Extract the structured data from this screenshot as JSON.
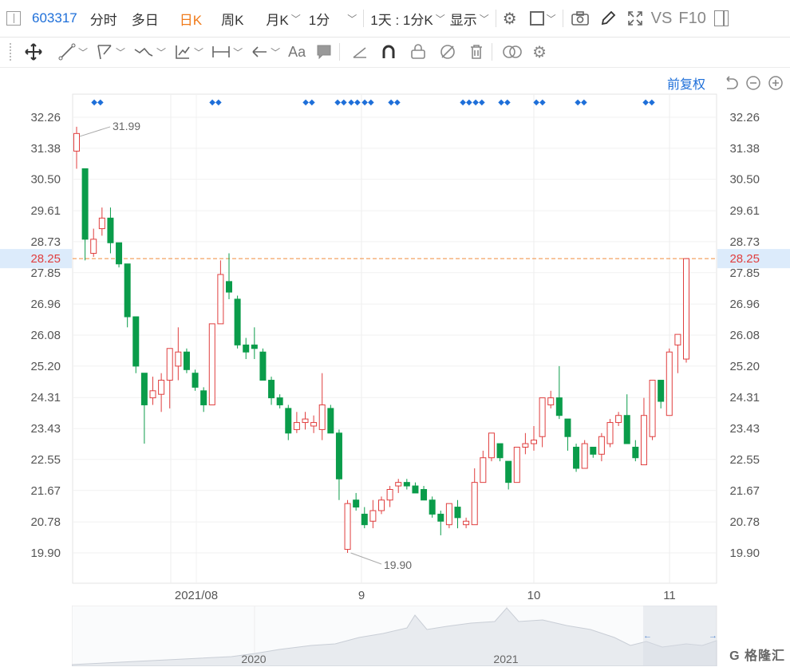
{
  "toolbar": {
    "stock_code": "603317",
    "tabs": [
      {
        "label": "分时",
        "active": false
      },
      {
        "label": "多日",
        "active": false
      },
      {
        "label": "日K",
        "active": true
      },
      {
        "label": "周K",
        "active": false
      },
      {
        "label": "月K",
        "active": false
      },
      {
        "label": "1分",
        "active": false
      }
    ],
    "range_label": "1天 : 1分K",
    "display_label": "显示",
    "vs_label": "VS",
    "f10_label": "F10"
  },
  "adjust_label": "前复权",
  "colors": {
    "up": "#e03e3e",
    "down": "#0a9c4a",
    "accent": "#1e6fd9",
    "current_line": "#f08c3c"
  },
  "chart_data": {
    "type": "candlestick",
    "y_ticks": [
      "32.26",
      "31.38",
      "30.50",
      "29.61",
      "28.73",
      "27.85",
      "26.96",
      "26.08",
      "25.20",
      "24.31",
      "23.43",
      "22.55",
      "21.67",
      "20.78",
      "19.90"
    ],
    "x_labels": [
      "2021/08",
      "9",
      "10",
      "11"
    ],
    "current_price": "28.25",
    "high_label": "31.99",
    "low_label": "19.90",
    "candles": [
      [
        31.3,
        31.8,
        30.8,
        31.99
      ],
      [
        30.8,
        28.8,
        28.2,
        30.8
      ],
      [
        28.4,
        28.8,
        28.3,
        29.1
      ],
      [
        29.1,
        29.4,
        28.9,
        29.7
      ],
      [
        29.4,
        28.7,
        28.4,
        29.7
      ],
      [
        28.7,
        28.1,
        28.0,
        28.7
      ],
      [
        28.1,
        26.6,
        26.3,
        28.1
      ],
      [
        26.6,
        25.2,
        25.0,
        26.6
      ],
      [
        25.0,
        24.1,
        23.0,
        25.0
      ],
      [
        24.3,
        24.5,
        24.1,
        24.9
      ],
      [
        24.4,
        24.8,
        23.9,
        25.0
      ],
      [
        24.8,
        25.7,
        24.0,
        25.7
      ],
      [
        25.2,
        25.6,
        24.8,
        26.3
      ],
      [
        25.6,
        25.1,
        25.0,
        25.7
      ],
      [
        25.0,
        24.6,
        24.5,
        25.1
      ],
      [
        24.5,
        24.1,
        23.9,
        24.6
      ],
      [
        24.1,
        26.4,
        24.1,
        26.4
      ],
      [
        26.4,
        27.8,
        26.4,
        28.2
      ],
      [
        27.6,
        27.3,
        27.1,
        28.4
      ],
      [
        27.1,
        25.8,
        25.7,
        27.2
      ],
      [
        25.8,
        25.6,
        25.4,
        26.0
      ],
      [
        25.8,
        25.7,
        25.4,
        26.3
      ],
      [
        25.6,
        24.8,
        24.8,
        25.7
      ],
      [
        24.8,
        24.3,
        24.1,
        24.9
      ],
      [
        24.3,
        24.1,
        24.0,
        24.4
      ],
      [
        24.0,
        23.3,
        23.1,
        24.1
      ],
      [
        23.4,
        23.6,
        23.3,
        23.9
      ],
      [
        23.6,
        23.7,
        23.4,
        23.9
      ],
      [
        23.5,
        23.6,
        23.3,
        23.8
      ],
      [
        23.4,
        24.1,
        23.1,
        25.0
      ],
      [
        24.0,
        23.3,
        23.3,
        24.1
      ],
      [
        23.3,
        22.0,
        21.4,
        23.4
      ],
      [
        20.0,
        21.3,
        19.9,
        21.4
      ],
      [
        21.4,
        21.2,
        21.1,
        21.6
      ],
      [
        21.0,
        20.7,
        20.6,
        21.2
      ],
      [
        20.8,
        21.1,
        20.6,
        21.4
      ],
      [
        21.1,
        21.4,
        21.0,
        21.5
      ],
      [
        21.4,
        21.7,
        21.2,
        21.8
      ],
      [
        21.8,
        21.9,
        21.6,
        22.0
      ],
      [
        21.9,
        21.8,
        21.7,
        22.0
      ],
      [
        21.8,
        21.6,
        21.6,
        21.9
      ],
      [
        21.7,
        21.4,
        21.4,
        21.8
      ],
      [
        21.4,
        21.0,
        20.9,
        21.5
      ],
      [
        21.0,
        20.8,
        20.4,
        21.1
      ],
      [
        20.7,
        21.3,
        20.6,
        21.3
      ],
      [
        21.2,
        20.9,
        20.6,
        21.4
      ],
      [
        20.7,
        20.8,
        20.6,
        20.9
      ],
      [
        20.7,
        21.9,
        20.7,
        22.3
      ],
      [
        21.9,
        22.6,
        21.9,
        22.8
      ],
      [
        22.6,
        23.3,
        22.5,
        23.3
      ],
      [
        23.0,
        22.6,
        22.5,
        23.0
      ],
      [
        22.5,
        21.9,
        21.7,
        22.5
      ],
      [
        21.9,
        22.9,
        21.9,
        22.9
      ],
      [
        22.9,
        23.0,
        22.7,
        23.3
      ],
      [
        23.0,
        23.1,
        22.8,
        23.5
      ],
      [
        23.2,
        24.3,
        22.9,
        24.3
      ],
      [
        24.1,
        24.3,
        24.0,
        24.5
      ],
      [
        24.3,
        23.8,
        23.7,
        25.2
      ],
      [
        23.7,
        23.2,
        22.8,
        23.7
      ],
      [
        22.9,
        22.3,
        22.2,
        23.0
      ],
      [
        22.3,
        23.0,
        22.3,
        23.1
      ],
      [
        22.9,
        22.7,
        22.6,
        22.9
      ],
      [
        22.7,
        23.2,
        22.5,
        23.3
      ],
      [
        23.0,
        23.6,
        22.9,
        23.7
      ],
      [
        23.6,
        23.8,
        23.5,
        23.9
      ],
      [
        23.8,
        23.0,
        23.0,
        24.4
      ],
      [
        22.9,
        22.6,
        22.5,
        23.1
      ],
      [
        22.4,
        23.8,
        22.4,
        24.3
      ],
      [
        23.2,
        24.8,
        23.1,
        24.8
      ],
      [
        24.8,
        24.2,
        24.0,
        24.8
      ],
      [
        23.8,
        25.6,
        23.8,
        25.7
      ],
      [
        25.8,
        26.1,
        25.0,
        26.1
      ],
      [
        25.4,
        28.25,
        25.3,
        28.25
      ]
    ],
    "markers_label": "◆◆"
  }
}
